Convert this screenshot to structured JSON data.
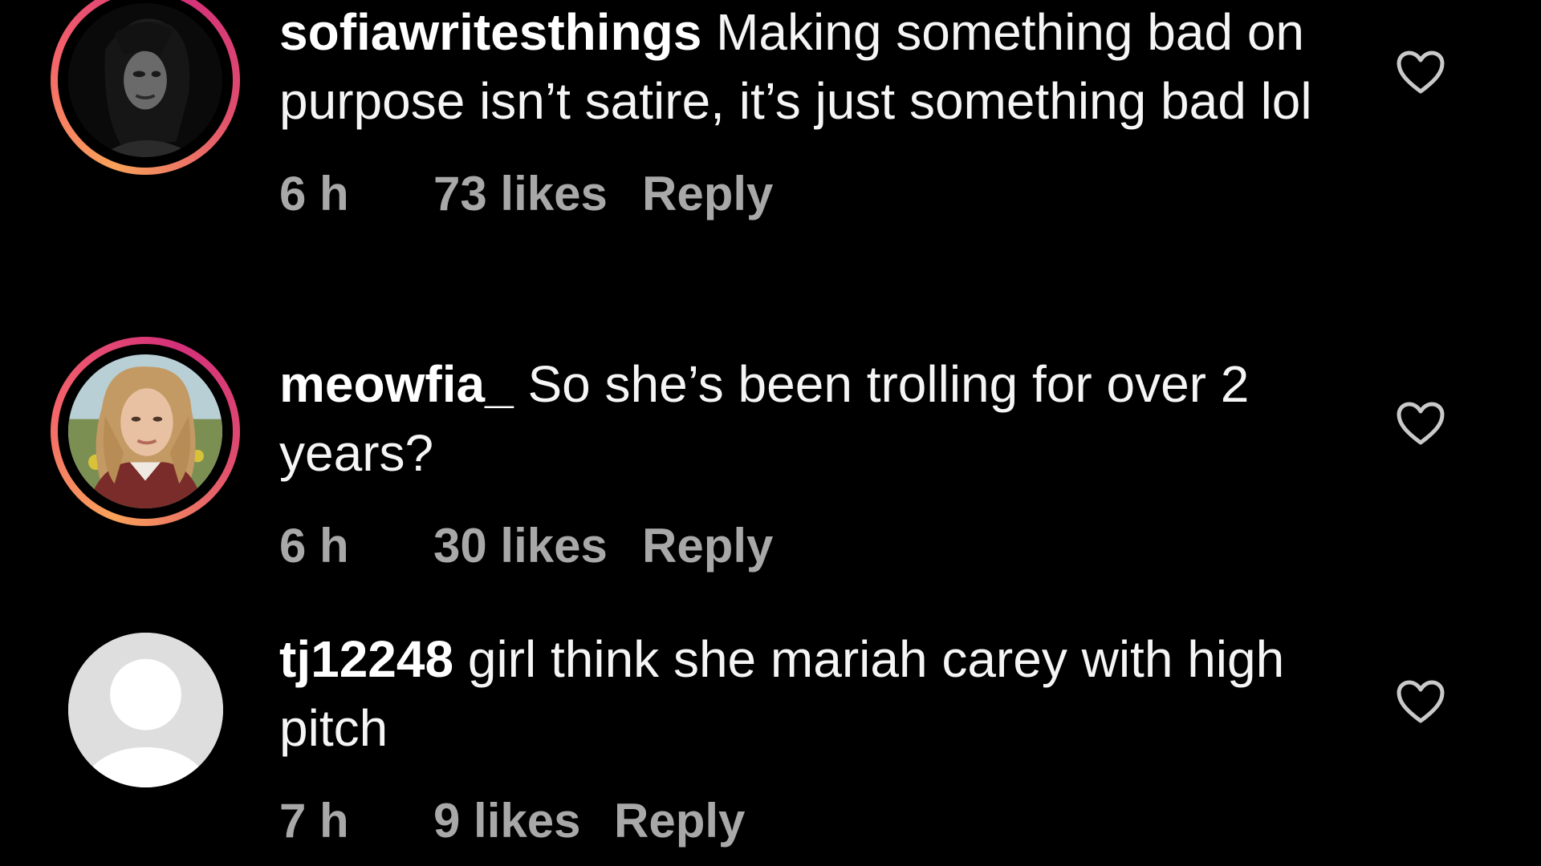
{
  "comments": [
    {
      "username": "sofiawritesthings",
      "text": "Making something bad on purpose isn’t satire, it’s just something bad lol",
      "time": "6 h",
      "likes": "73 likes",
      "reply": "Reply",
      "avatar": "dark-portrait-photo",
      "story_ring": true
    },
    {
      "username": "meowfia_",
      "text": "So she’s been trolling for over 2 years?",
      "time": "6 h",
      "likes": "30 likes",
      "reply": "Reply",
      "avatar": "blonde-portrait-photo",
      "story_ring": true
    },
    {
      "username": "tj12248",
      "text": "girl think she mariah carey with high pitch",
      "time": "7 h",
      "likes": "9 likes",
      "reply": "Reply",
      "avatar": "default-profile-icon",
      "story_ring": false
    }
  ],
  "colors": {
    "background": "#000000",
    "text": "#f5f5f5",
    "meta": "#a8a8a8",
    "ring_start": "#f9a25a",
    "ring_end": "#d3307a"
  }
}
